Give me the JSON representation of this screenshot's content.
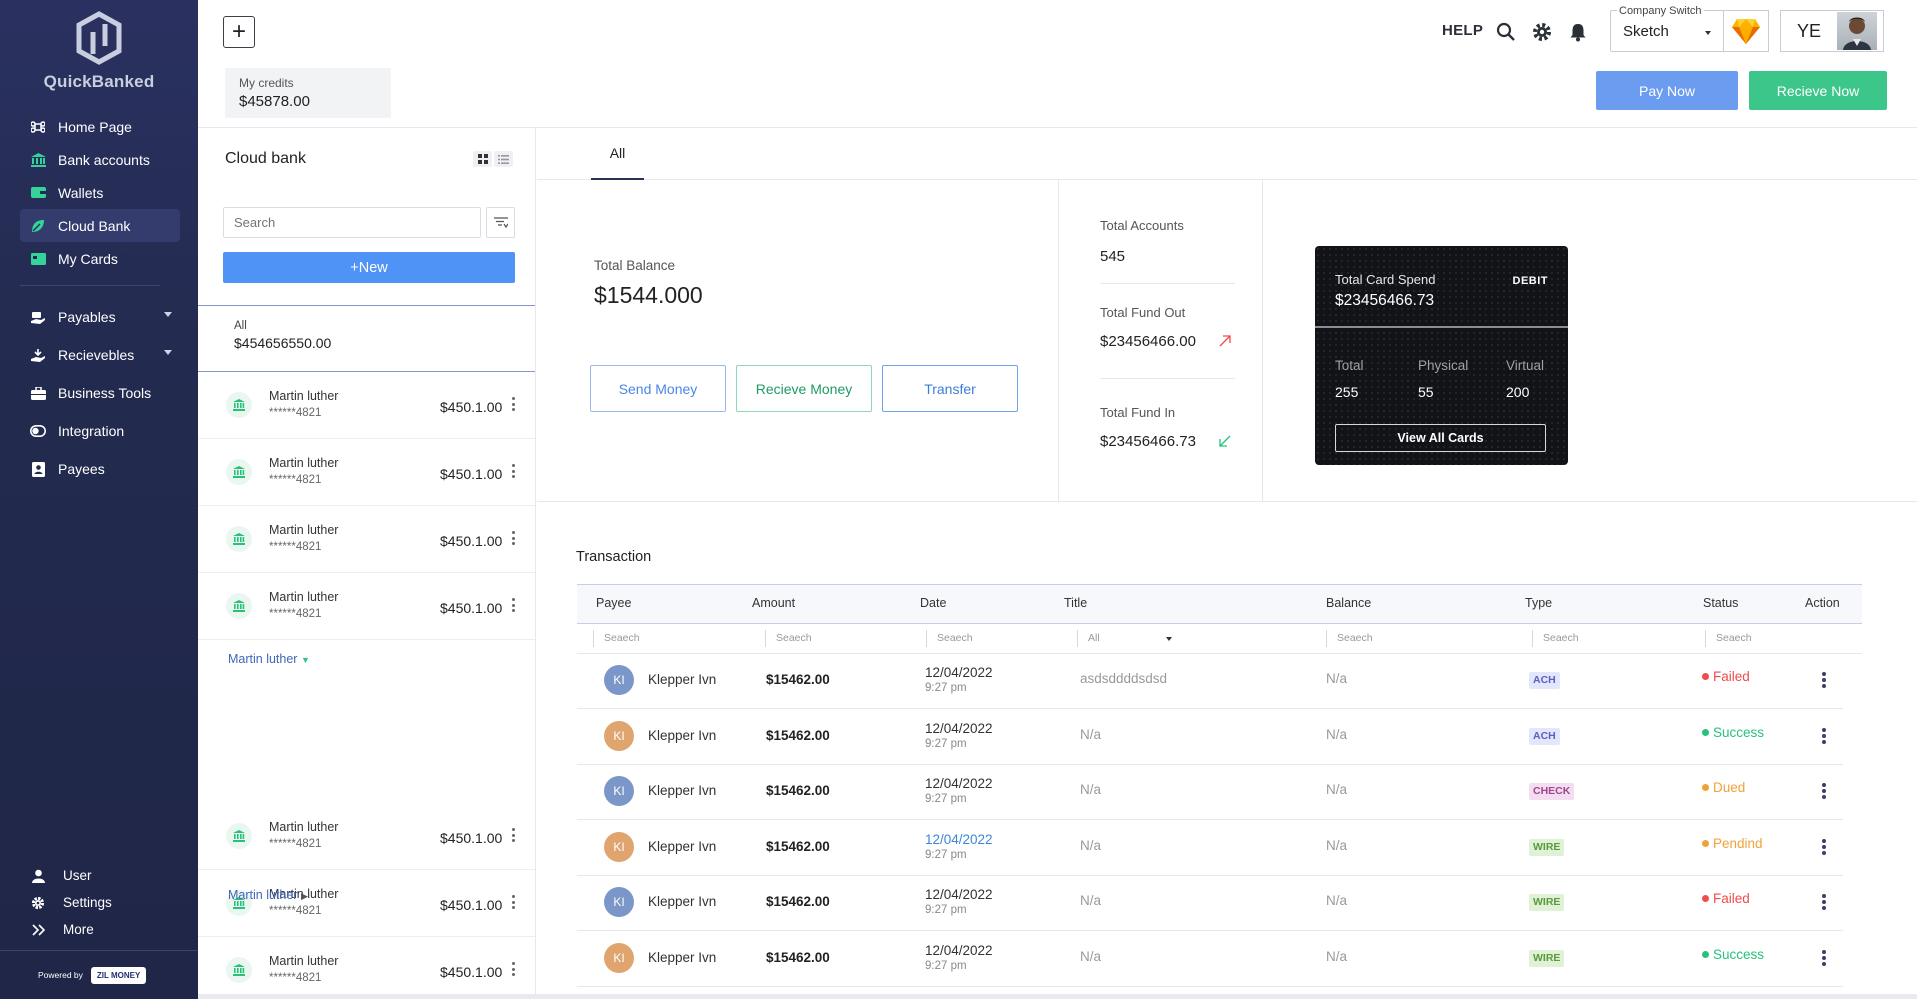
{
  "brand": {
    "name": "QuickBanked"
  },
  "sidebar": {
    "items": [
      {
        "label": "Home Page",
        "icon": "command-icon"
      },
      {
        "label": "Bank accounts",
        "icon": "bank-icon"
      },
      {
        "label": "Wallets",
        "icon": "wallet-icon"
      },
      {
        "label": "Cloud Bank",
        "icon": "leaf-icon",
        "active": true
      },
      {
        "label": "My Cards",
        "icon": "card-icon"
      }
    ],
    "items2": [
      {
        "label": "Payables",
        "icon": "hand-coins-icon",
        "caret": true
      },
      {
        "label": "Recievebles",
        "icon": "hand-receive-icon",
        "caret": true
      },
      {
        "label": "Business Tools",
        "icon": "briefcase-icon"
      },
      {
        "label": "Integration",
        "icon": "toggle-icon"
      },
      {
        "label": "Payees",
        "icon": "contact-icon"
      }
    ],
    "bottom": [
      {
        "label": "User",
        "icon": "user-icon"
      },
      {
        "label": "Settings",
        "icon": "gear-icon"
      },
      {
        "label": "More",
        "icon": "chevrons-right-icon"
      }
    ],
    "powered_by": "Powered by",
    "powered_brand": "ZIL MONEY"
  },
  "header": {
    "credits_label": "My credits",
    "credits_value": "$45878.00",
    "help": "HELP",
    "company_switch_label": "Company Switch",
    "company_switch_value": "Sketch",
    "user_initials": "YE",
    "pay_now": "Pay Now",
    "recieve_now": "Recieve Now"
  },
  "panel": {
    "title": "Cloud bank",
    "search_placeholder": "Search",
    "new_label": "New",
    "all_label": "All",
    "all_value": "$454656550.00",
    "group1": [
      {
        "name": "Martin luther",
        "number": "******4821",
        "amount": "$450.1.00"
      },
      {
        "name": "Martin luther",
        "number": "******4821",
        "amount": "$450.1.00"
      },
      {
        "name": "Martin luther",
        "number": "******4821",
        "amount": "$450.1.00"
      },
      {
        "name": "Martin luther",
        "number": "******4821",
        "amount": "$450.1.00"
      }
    ],
    "group_header_open": "Martin luther",
    "group2": [
      {
        "name": "Martin luther",
        "number": "******4821",
        "amount": "$450.1.00"
      },
      {
        "name": "Martin luther",
        "number": "******4821",
        "amount": "$450.1.00"
      },
      {
        "name": "Martin luther",
        "number": "******4821",
        "amount": "$450.1.00"
      }
    ],
    "group_header_closed": "Martin luther"
  },
  "main": {
    "tab_all": "All",
    "total_balance_label": "Total Balance",
    "total_balance_value": "$1544.000",
    "send_money": "Send Money",
    "recieve_money": "Recieve Money",
    "transfer": "Transfer",
    "total_accounts_label": "Total Accounts",
    "total_accounts_value": "545",
    "total_fund_out_label": "Total Fund Out",
    "total_fund_out_value": "$23456466.00",
    "total_fund_in_label": "Total Fund In",
    "total_fund_in_value": "$23456466.73",
    "card": {
      "spend_label": "Total Card Spend",
      "spend_value": "$23456466.73",
      "type": "DEBIT",
      "total_label": "Total",
      "total_value": "255",
      "physical_label": "Physical",
      "physical_value": "55",
      "virtual_label": "Virtual",
      "virtual_value": "200",
      "view_all": "View All Cards"
    }
  },
  "transactions": {
    "title": "Transaction",
    "columns": [
      "Payee",
      "Amount",
      "Date",
      "Title",
      "Balance",
      "Type",
      "Status",
      "Action"
    ],
    "filter_placeholder": "Seaech",
    "title_filter_value": "All",
    "rows": [
      {
        "initials": "KI",
        "avatar_color": "#7b96c9",
        "payee": "Klepper Ivn",
        "amount": "$15462.00",
        "date": "12/04/2022",
        "time": "9:27 pm",
        "date_link": false,
        "title": "asdsddddsdsd",
        "balance": "N/a",
        "type": "ACH",
        "status": "Failed"
      },
      {
        "initials": "KI",
        "avatar_color": "#e0a56f",
        "payee": "Klepper Ivn",
        "amount": "$15462.00",
        "date": "12/04/2022",
        "time": "9:27 pm",
        "date_link": false,
        "title": "N/a",
        "balance": "N/a",
        "type": "ACH",
        "status": "Success"
      },
      {
        "initials": "KI",
        "avatar_color": "#7b96c9",
        "payee": "Klepper Ivn",
        "amount": "$15462.00",
        "date": "12/04/2022",
        "time": "9:27 pm",
        "date_link": false,
        "title": "N/a",
        "balance": "N/a",
        "type": "CHECK",
        "status": "Dued"
      },
      {
        "initials": "KI",
        "avatar_color": "#e0a56f",
        "payee": "Klepper Ivn",
        "amount": "$15462.00",
        "date": "12/04/2022",
        "time": "9:27 pm",
        "date_link": true,
        "title": "N/a",
        "balance": "N/a",
        "type": "WIRE",
        "status": "Pendind"
      },
      {
        "initials": "KI",
        "avatar_color": "#7b96c9",
        "payee": "Klepper Ivn",
        "amount": "$15462.00",
        "date": "12/04/2022",
        "time": "9:27 pm",
        "date_link": false,
        "title": "N/a",
        "balance": "N/a",
        "type": "WIRE",
        "status": "Failed"
      },
      {
        "initials": "KI",
        "avatar_color": "#e0a56f",
        "payee": "Klepper Ivn",
        "amount": "$15462.00",
        "date": "12/04/2022",
        "time": "9:27 pm",
        "date_link": false,
        "title": "N/a",
        "balance": "N/a",
        "type": "WIRE",
        "status": "Success"
      }
    ]
  },
  "colors": {
    "sidebar_bg": "#232a4f",
    "accent_blue": "#4f93f6",
    "accent_green": "#3cc689",
    "failed": "#ef4b4b",
    "success": "#27c27a",
    "pending": "#f0a13a",
    "type_ach_bg": "#e4e6fb",
    "type_ach_fg": "#5661c4",
    "type_check_bg": "#f3ddf0",
    "type_check_fg": "#a0458e",
    "type_wire_bg": "#dff2d6",
    "type_wire_fg": "#5a9a3d"
  }
}
